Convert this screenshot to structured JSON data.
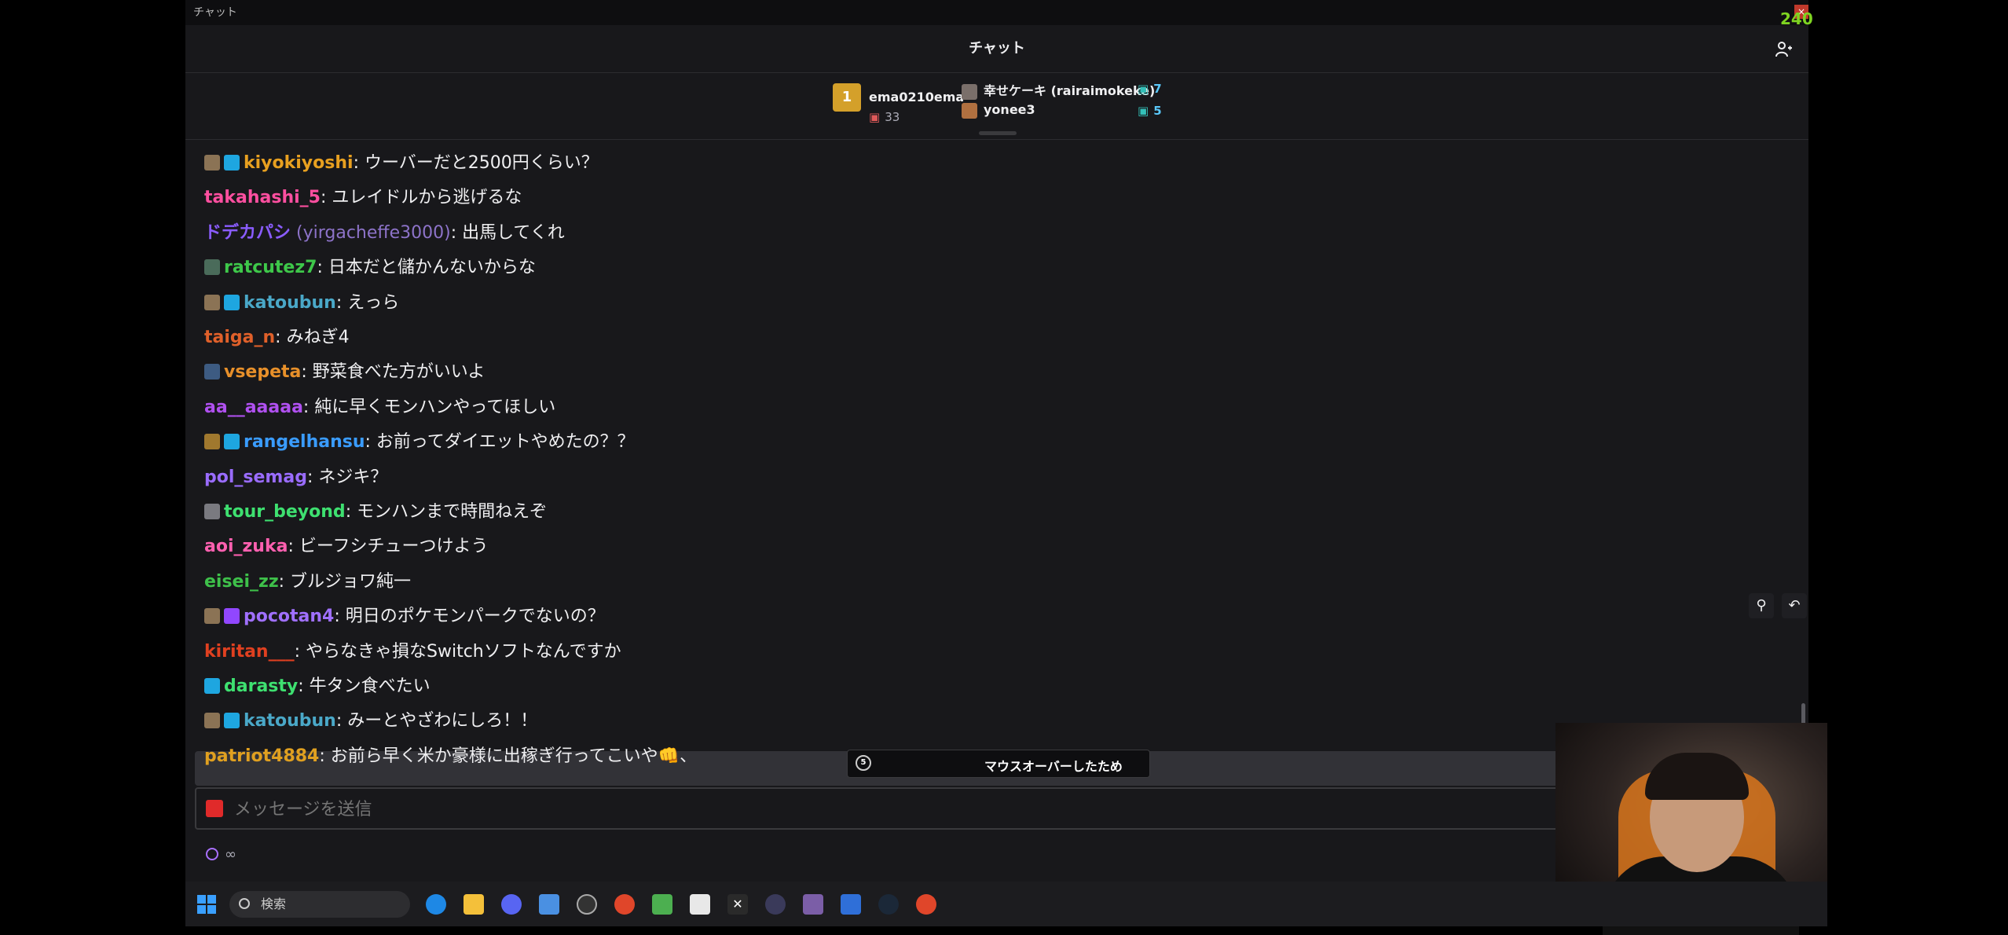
{
  "window": {
    "title": "チャット",
    "header": "チャット",
    "fps": "240"
  },
  "leaderboard": {
    "top": {
      "rank": "1",
      "name": "ema0210ema",
      "count": "33"
    },
    "entries": [
      {
        "name": "幸せケーキ (rairaimokeke)",
        "count": "7"
      },
      {
        "name": "yonee3",
        "count": "5"
      }
    ]
  },
  "messages": [
    {
      "badges": [
        "sub",
        "crown"
      ],
      "user": "kiyokiyoshi",
      "color": "#e8a020",
      "text": "ウーバーだと2500円くらい？"
    },
    {
      "badges": [],
      "user": "takahashi_5",
      "color": "#ff4fa0",
      "text": "ユレイドルから逃げるな"
    },
    {
      "badges": [],
      "user": "ドデカパシ",
      "alias": "(yirgacheffe3000)",
      "color": "#8a5cff",
      "text": "出馬してくれ"
    },
    {
      "badges": [
        "gear"
      ],
      "user": "ratcutez7",
      "color": "#3ec84a",
      "text": "日本だと儲かんないからな"
    },
    {
      "badges": [
        "sub",
        "crown"
      ],
      "user": "katoubun",
      "color": "#4aa8c8",
      "text": "えっら"
    },
    {
      "badges": [],
      "user": "taiga_n",
      "color": "#e0602a",
      "text": "みねぎ4"
    },
    {
      "badges": [
        "cube"
      ],
      "user": "vsepeta",
      "color": "#e8902a",
      "text": "野菜食べた方がいいよ"
    },
    {
      "badges": [],
      "user": "aa__aaaaa",
      "color": "#b050f0",
      "text": "純に早くモンハンやってほしい"
    },
    {
      "badges": [
        "box",
        "crown"
      ],
      "user": "rangelhansu",
      "color": "#3a9cff",
      "text": "お前ってダイエットやめたの？？"
    },
    {
      "badges": [],
      "user": "pol_semag",
      "color": "#9a6cff",
      "text": "ネジキ？"
    },
    {
      "badges": [
        "gray"
      ],
      "user": "tour_beyond",
      "color": "#3ee070",
      "text": "モンハンまで時間ねえぞ"
    },
    {
      "badges": [],
      "user": "aoi_zuka",
      "color": "#ff60b0",
      "text": "ビーフシチューつけよう"
    },
    {
      "badges": [],
      "user": "eisei_zz",
      "color": "#3ec04a",
      "text": "ブルジョワ純一"
    },
    {
      "badges": [
        "sub",
        "vip"
      ],
      "user": "pocotan4",
      "color": "#a070ff",
      "text": "明日のポケモンパークでないの？"
    },
    {
      "badges": [],
      "user": "kiritan___",
      "color": "#e04020",
      "text": "やらなきゃ損なSwitchソフトなんですか"
    },
    {
      "badges": [
        "crown"
      ],
      "user": "darasty",
      "color": "#3ee070",
      "text": "牛タン食べたい"
    },
    {
      "badges": [
        "sub",
        "crown"
      ],
      "user": "katoubun",
      "color": "#4aa8c8",
      "text": "みーとやざわにしろ！！"
    },
    {
      "badges": [],
      "user": "patriot4884",
      "color": "#e0a020",
      "text": "お前ら早く米か豪様に出稼ぎ行ってこいや👊、"
    }
  ],
  "paused": {
    "text": "マウスオーバーしたため"
  },
  "input": {
    "placeholder": "メッセージを送信"
  },
  "points": {
    "value": "∞"
  },
  "taskbar": {
    "search_label": "検索"
  },
  "colors": {
    "bg": "#18181b",
    "accent": "#9147ff"
  }
}
